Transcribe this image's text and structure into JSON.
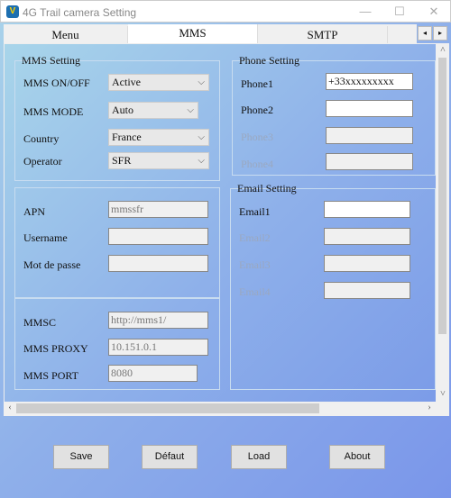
{
  "window": {
    "title": "4G Trail camera Setting",
    "minimize": "—",
    "maximize": "☐",
    "close": "✕"
  },
  "tabs": [
    {
      "label": "Menu"
    },
    {
      "label": "MMS",
      "selected": true
    },
    {
      "label": "SMTP"
    }
  ],
  "tab_scroll": {
    "left": "◂",
    "right": "▸"
  },
  "mms_setting": {
    "legend": "MMS Setting",
    "on_off": {
      "label": "MMS ON/OFF",
      "value": "Active"
    },
    "mode": {
      "label": "MMS MODE",
      "value": "Auto"
    },
    "country": {
      "label": "Country",
      "value": "France"
    },
    "operator": {
      "label": "Operator",
      "value": "SFR"
    }
  },
  "apn": {
    "label": "APN",
    "value": "mmssfr"
  },
  "username": {
    "label": "Username",
    "value": ""
  },
  "password": {
    "label": "Mot de passe",
    "value": ""
  },
  "mmsc": {
    "label": "MMSC",
    "value": "http://mms1/"
  },
  "proxy": {
    "label": "MMS PROXY",
    "value": "10.151.0.1"
  },
  "port": {
    "label": "MMS PORT",
    "value": "8080"
  },
  "phone_setting": {
    "legend": "Phone Setting",
    "phones": [
      {
        "label": "Phone1",
        "value": "+33xxxxxxxxx"
      },
      {
        "label": "Phone2",
        "value": ""
      },
      {
        "label": "Phone3",
        "value": ""
      },
      {
        "label": "Phone4",
        "value": ""
      }
    ]
  },
  "email_setting": {
    "legend": "Email Setting",
    "emails": [
      {
        "label": "Email1",
        "value": ""
      },
      {
        "label": "Email2",
        "value": ""
      },
      {
        "label": "Email3",
        "value": ""
      },
      {
        "label": "Email4",
        "value": ""
      }
    ]
  },
  "scroll": {
    "up": "˄",
    "down": "˅",
    "left": "‹",
    "right": "›"
  },
  "buttons": {
    "save": "Save",
    "default": "Défaut",
    "load": "Load",
    "about": "About"
  }
}
